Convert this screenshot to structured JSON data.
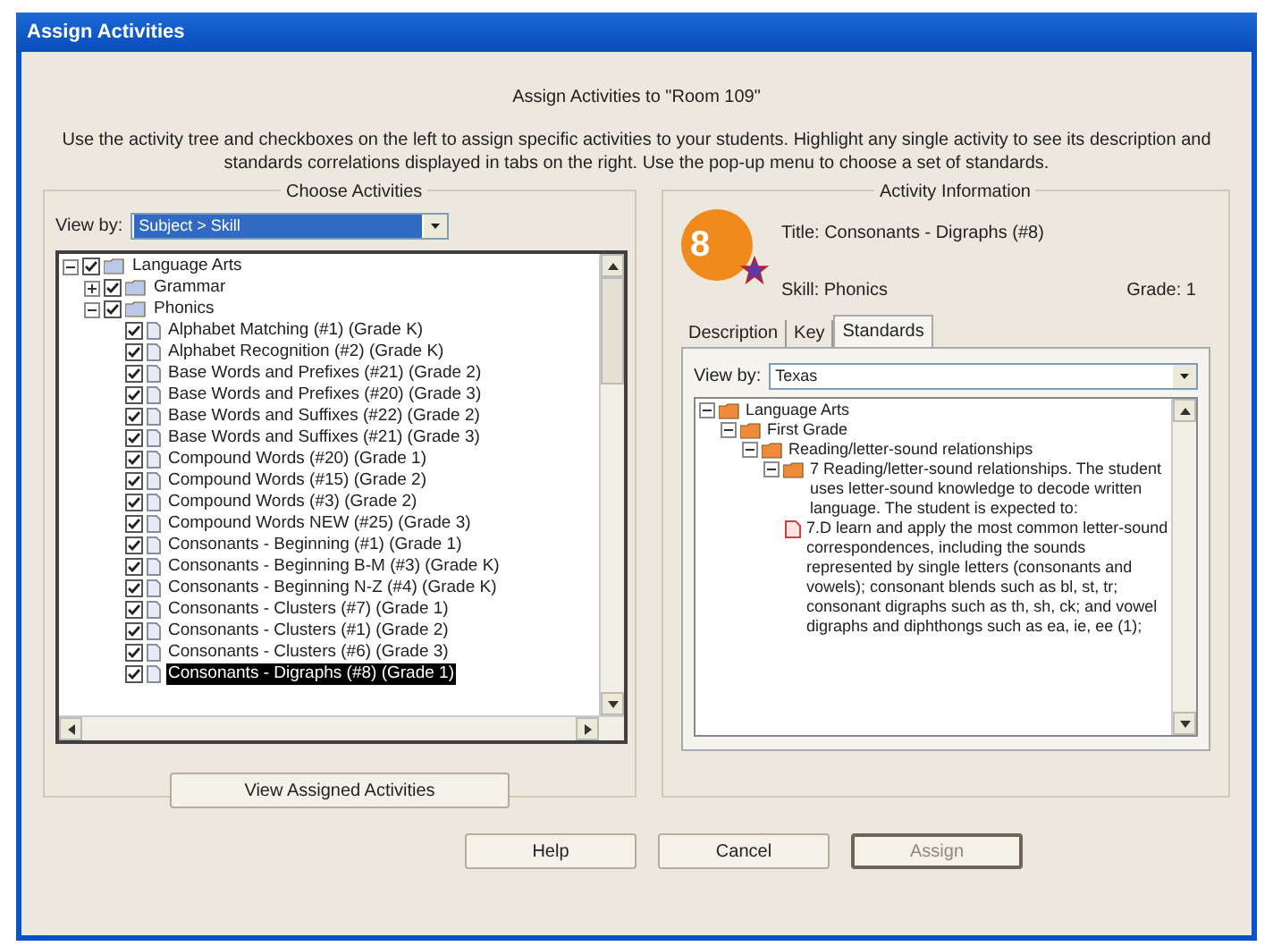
{
  "window": {
    "title": "Assign Activities"
  },
  "heading": "Assign Activities to \"Room 109\"",
  "instructions": "Use the activity tree and checkboxes on the left to assign specific activities to your students. Highlight any single activity to see its description and standards correlations displayed in tabs on the right. Use the pop-up menu to choose a set of standards.",
  "choose_activities": {
    "title": "Choose Activities",
    "view_by_label": "View by:",
    "view_by_value": "Subject > Skill",
    "tree": [
      {
        "kind": "folder",
        "label": "Language Arts",
        "expanded": true,
        "checked": true,
        "children": [
          {
            "kind": "folder",
            "label": "Grammar",
            "expanded": false,
            "checked": true
          },
          {
            "kind": "folder",
            "label": "Phonics",
            "expanded": true,
            "checked": true,
            "children": [
              {
                "kind": "activity",
                "label": "Alphabet Matching (#1) (Grade K)",
                "checked": true,
                "selected": false
              },
              {
                "kind": "activity",
                "label": "Alphabet Recognition (#2) (Grade K)",
                "checked": true,
                "selected": false
              },
              {
                "kind": "activity",
                "label": "Base Words and Prefixes (#21) (Grade 2)",
                "checked": true,
                "selected": false
              },
              {
                "kind": "activity",
                "label": "Base Words and Prefixes (#20) (Grade 3)",
                "checked": true,
                "selected": false
              },
              {
                "kind": "activity",
                "label": "Base Words and Suffixes (#22) (Grade 2)",
                "checked": true,
                "selected": false
              },
              {
                "kind": "activity",
                "label": "Base Words and Suffixes (#21) (Grade 3)",
                "checked": true,
                "selected": false
              },
              {
                "kind": "activity",
                "label": "Compound Words (#20) (Grade 1)",
                "checked": true,
                "selected": false
              },
              {
                "kind": "activity",
                "label": "Compound Words (#15) (Grade 2)",
                "checked": true,
                "selected": false
              },
              {
                "kind": "activity",
                "label": "Compound Words (#3) (Grade 2)",
                "checked": true,
                "selected": false
              },
              {
                "kind": "activity",
                "label": "Compound Words NEW (#25) (Grade 3)",
                "checked": true,
                "selected": false
              },
              {
                "kind": "activity",
                "label": "Consonants - Beginning (#1) (Grade 1)",
                "checked": true,
                "selected": false
              },
              {
                "kind": "activity",
                "label": "Consonants - Beginning B-M (#3) (Grade K)",
                "checked": true,
                "selected": false
              },
              {
                "kind": "activity",
                "label": "Consonants - Beginning N-Z (#4) (Grade K)",
                "checked": true,
                "selected": false
              },
              {
                "kind": "activity",
                "label": "Consonants - Clusters (#7) (Grade 1)",
                "checked": true,
                "selected": false
              },
              {
                "kind": "activity",
                "label": "Consonants - Clusters (#1) (Grade 2)",
                "checked": true,
                "selected": false
              },
              {
                "kind": "activity",
                "label": "Consonants - Clusters (#6) (Grade 3)",
                "checked": true,
                "selected": false
              },
              {
                "kind": "activity",
                "label": "Consonants - Digraphs (#8) (Grade 1)",
                "checked": true,
                "selected": true
              }
            ]
          }
        ]
      }
    ],
    "button": "View Assigned Activities"
  },
  "activity_information": {
    "title": "Activity Information",
    "badge": "8",
    "activity_title": "Title:  Consonants - Digraphs (#8)",
    "skill": "Skill:  Phonics",
    "grade": "Grade:  1",
    "tabs": [
      {
        "label": "Description",
        "selected": false
      },
      {
        "label": "Key",
        "selected": false
      },
      {
        "label": "Standards",
        "selected": true
      }
    ],
    "view_by_label": "View by:",
    "view_by_value": "Texas",
    "standards_tree": [
      {
        "kind": "folder",
        "label": "Language Arts",
        "expanded": true,
        "children": [
          {
            "kind": "folder",
            "label": "First Grade",
            "expanded": true,
            "children": [
              {
                "kind": "folder",
                "label": "Reading/letter-sound relationships",
                "expanded": true,
                "children": [
                  {
                    "kind": "folder",
                    "label": "7 Reading/letter-sound relationships. The student uses letter-sound knowledge to decode written language. The student is expected to:",
                    "expanded": true,
                    "children": [
                      {
                        "kind": "document",
                        "label": "7.D learn and apply the most common letter-sound correspondences, including the sounds represented by single letters (consonants and vowels); consonant blends such as bl, st, tr; consonant digraphs such as th, sh, ck; and vowel digraphs and diphthongs such as ea, ie, ee (1);"
                      }
                    ]
                  }
                ]
              }
            ]
          }
        ]
      }
    ]
  },
  "buttons": [
    {
      "label": "Help",
      "disabled": false
    },
    {
      "label": "Cancel",
      "disabled": false
    },
    {
      "label": "Assign",
      "disabled": true
    }
  ]
}
